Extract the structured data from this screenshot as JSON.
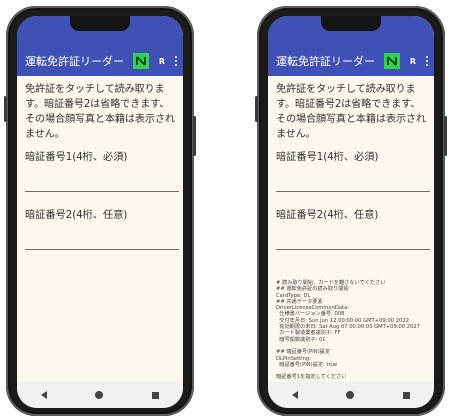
{
  "left_phone": {
    "app_title": "運転免許証リーダー",
    "r_label": "R",
    "instruction": "免許証をタッチして読み取ります。暗証番号2は省略できます、その場合顔写真と本籍は表示されません。",
    "pin1_label": "暗証番号1(4桁、必須)",
    "pin2_label": "暗証番号2(4桁、任意)"
  },
  "right_phone": {
    "app_title": "運転免許証リーダー",
    "r_label": "R",
    "instruction": "免許証をタッチして読み取ります。暗証番号2は省略できます、その場合顔写真と本籍は表示されません。",
    "pin1_label": "暗証番号1(4桁、必須)",
    "pin2_label": "暗証番号2(4桁、任意)",
    "log_lines": [
      "# 読み取り開始、カードを離さないでください",
      "## 運転免許証の読み取り開始",
      "CardType: DL",
      "## 共通データ要素",
      "DriverLicenseCommonData:",
      "  仕様書バージョン番号: 008",
      "  交付年月日: Sun Jun 12 00:00:00 GMT+09:00 2022",
      "  有効期限の末日: Sat Aug 07 00:00:00 GMT+09:00 2027",
      "  カード製造業者識別子: FF",
      "  暗号関数識別子: 01",
      "",
      "## 暗証番号(PIN)設定",
      "DLPinSetting:",
      "  暗証番号(PIN)設定: true",
      "",
      "暗証番号1を指定してください"
    ]
  },
  "colors": {
    "appbar": "#3f51b5",
    "screen_bg": "#fdf8ee",
    "nfc_icon": "#2fd353",
    "navbar": "#f1f1f1"
  },
  "icons": [
    "nfc-icon",
    "kebab-menu-icon",
    "back-icon",
    "home-icon",
    "recents-icon"
  ]
}
